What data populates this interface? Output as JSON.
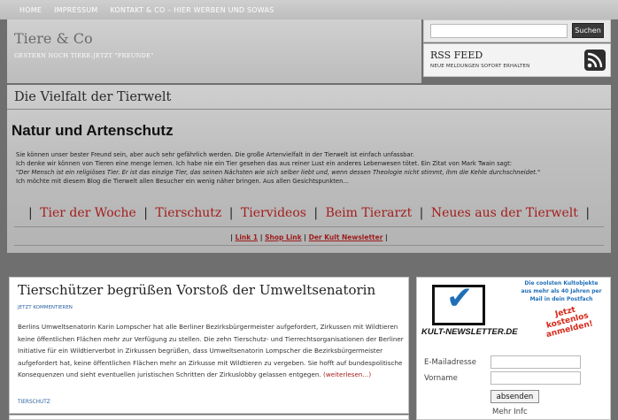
{
  "topnav": {
    "items": [
      "HOME",
      "IMPRESSUM",
      "KONTAKT & CO – HIER WERBEN UND SOWAS"
    ]
  },
  "header": {
    "title": "Tiere & Co",
    "tagline": "GESTERN NOCH TIERE-JETZT \"FREUNDE\""
  },
  "search": {
    "placeholder": "",
    "button_label": "Suchen"
  },
  "rss": {
    "title": "RSS FEED",
    "subtitle": "NEUE MELDUNGEN SOFORT ERHALTEN",
    "icon": "rss-icon"
  },
  "banner": {
    "title": "Die Vielfalt der Tierwelt",
    "heading": "Natur und Artenschutz",
    "lines": [
      "Sie können unser bester Freund sein, aber auch sehr gefährlich werden. Die große Artenvielfalt in der Tierwelt ist einfach unfassbar.",
      "Ich denke wir können von Tieren eine menge lernen. Ich habe nie ein Tier gesehen das aus reiner Lust ein anderes Lebenwesen tötet. Ein Zitat von Mark Twain sagt:"
    ],
    "quote": "\"Der Mensch ist ein religiöses Tier. Er ist das einzige Tier, das seinen Nächsten wie sich selber liebt und, wenn dessen Theologie nicht stimmt, ihm die Kehle durchschneidet.\"",
    "closing": "Ich möchte mit diesem Blog die Tierwelt allen Besucher ein wenig näher bringen. Aus allen Gesichtspunkten...",
    "nav_big": [
      "Tier der Woche",
      "Tierschutz",
      "Tiervideos",
      "Beim Tierarzt",
      "Neues aus der Tierwelt"
    ],
    "nav_small": [
      "Link 1",
      "Shop Link",
      "Der Kult Newsletter"
    ]
  },
  "post": {
    "title": "Tierschützer begrüßen Vorstoß der Umweltsenatorin",
    "comment_link": "JETZT KOMMENTIEREN",
    "body": "Berlins Umweltsenatorin Karin Lompscher hat alle Berliner Bezirksbürgermeister aufgefordert, Zirkussen mit Wildtieren keine öffentlichen Flächen mehr zur Verfügung zu stellen. Die zehn Tierschutz- und Tierrechtsorganisationen der Berliner Initiative für ein Wildtierverbot in Zirkussen begrüßen, dass Umweltsenatorin Lompscher die Bezirksbürgermeister aufgefordert hat, keine öffentlichen Flächen mehr an Zirkusse mit Wildtieren zu vergeben. Sie hofft auf bundespolitische Konsequenzen und sieht eventuellen juristischen Schritten der Zirkuslobby gelassen entgegen.",
    "read_more": "(weiterlesen...)",
    "tag": "TIERSCHUTZ"
  },
  "widget": {
    "banner_text": "Die coolsten Kultobjekte aus mehr als 40 Jahren per Mail in dein Postfach",
    "banner_badge": "Jetzt kostenlos anmelden!",
    "banner_logo": "KULT-NEWSLETTER.DE",
    "email_label": "E-Mailadresse",
    "name_label": "Vorname",
    "submit_label": "absenden",
    "more_label": "Mehr Infc"
  },
  "colors": {
    "link_red": "#a41d1d",
    "meta_blue": "#2a62a2"
  }
}
